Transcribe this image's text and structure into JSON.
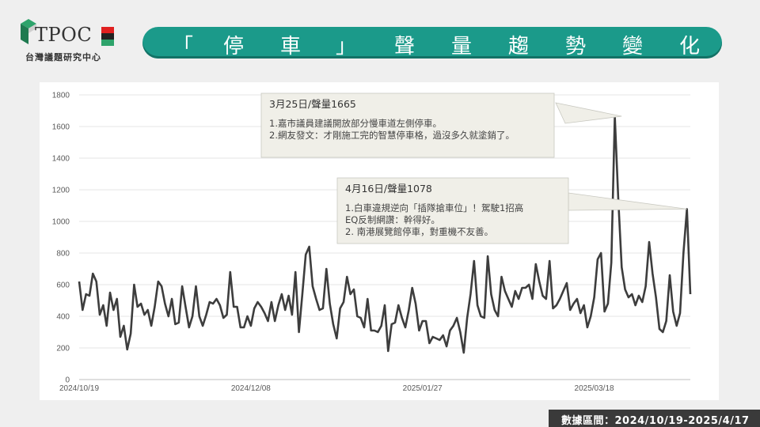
{
  "logo": {
    "word": "TPOC",
    "subtitle": "台灣議題研究中心"
  },
  "banner": {
    "chars": [
      "「",
      "停",
      "車",
      "」",
      "聲",
      "量",
      "趨",
      "勢",
      "變",
      "化"
    ]
  },
  "footer": {
    "label": "數據區間：2024/10/19-2025/4/17"
  },
  "colors": {
    "accent": "#1b9a8a",
    "line": "#3d3d3d",
    "callout_bg": "#f0efe8"
  },
  "chart_data": {
    "type": "line",
    "title": "",
    "xlabel": "",
    "ylabel": "",
    "ylim": [
      0,
      1800
    ],
    "yticks": [
      "0",
      "200",
      "400",
      "600",
      "800",
      "1000",
      "1200",
      "1400",
      "1600",
      "1800"
    ],
    "xticks": [
      {
        "label": "2024/10/19",
        "index": 0
      },
      {
        "label": "2024/12/08",
        "index": 50
      },
      {
        "label": "2025/01/27",
        "index": 100
      },
      {
        "label": "2025/03/18",
        "index": 150
      }
    ],
    "grid": "horizontal",
    "start_date": "2024/10/19",
    "series": [
      {
        "values": [
          620,
          440,
          540,
          530,
          670,
          620,
          410,
          470,
          340,
          550,
          440,
          510,
          270,
          340,
          190,
          290,
          600,
          460,
          480,
          410,
          440,
          340,
          460,
          620,
          590,
          480,
          400,
          510,
          350,
          360,
          590,
          460,
          330,
          400,
          590,
          400,
          340,
          410,
          490,
          480,
          510,
          470,
          390,
          410,
          680,
          460,
          460,
          330,
          330,
          400,
          340,
          450,
          490,
          460,
          420,
          370,
          490,
          370,
          470,
          540,
          440,
          530,
          410,
          680,
          300,
          540,
          790,
          840,
          590,
          510,
          440,
          450,
          700,
          480,
          350,
          260,
          450,
          490,
          650,
          540,
          570,
          400,
          390,
          330,
          510,
          310,
          310,
          300,
          340,
          470,
          180,
          350,
          360,
          470,
          390,
          330,
          440,
          580,
          480,
          310,
          370,
          370,
          230,
          270,
          260,
          250,
          280,
          210,
          310,
          340,
          390,
          300,
          170,
          390,
          540,
          750,
          470,
          400,
          390,
          780,
          540,
          440,
          400,
          650,
          560,
          510,
          460,
          560,
          510,
          580,
          580,
          600,
          510,
          730,
          620,
          530,
          510,
          750,
          450,
          470,
          510,
          560,
          610,
          440,
          480,
          510,
          420,
          470,
          330,
          400,
          520,
          760,
          800,
          430,
          480,
          740,
          1665,
          1150,
          710,
          570,
          520,
          540,
          470,
          530,
          490,
          590,
          870,
          670,
          520,
          320,
          300,
          370,
          660,
          430,
          340,
          420,
          800,
          1078,
          540
        ]
      }
    ],
    "annotations": [
      {
        "title": "3月25日/聲量1665",
        "lines": [
          "1.嘉市議員建議開放部分慢車道左側停車。",
          "2.網友發文：才剛施工完的智慧停車格，過沒多久就塗銷了。"
        ],
        "target_index": 158,
        "target_value": 1665
      },
      {
        "title": "4月16日/聲量1078",
        "lines": [
          "1.白車違規逆向「插隊搶車位」！駕駛1招高",
          "EQ反制網讚：幹得好。",
          "2. 南港展覽館停車，對重機不友善。"
        ],
        "target_index": 177,
        "target_value": 1078
      }
    ]
  }
}
